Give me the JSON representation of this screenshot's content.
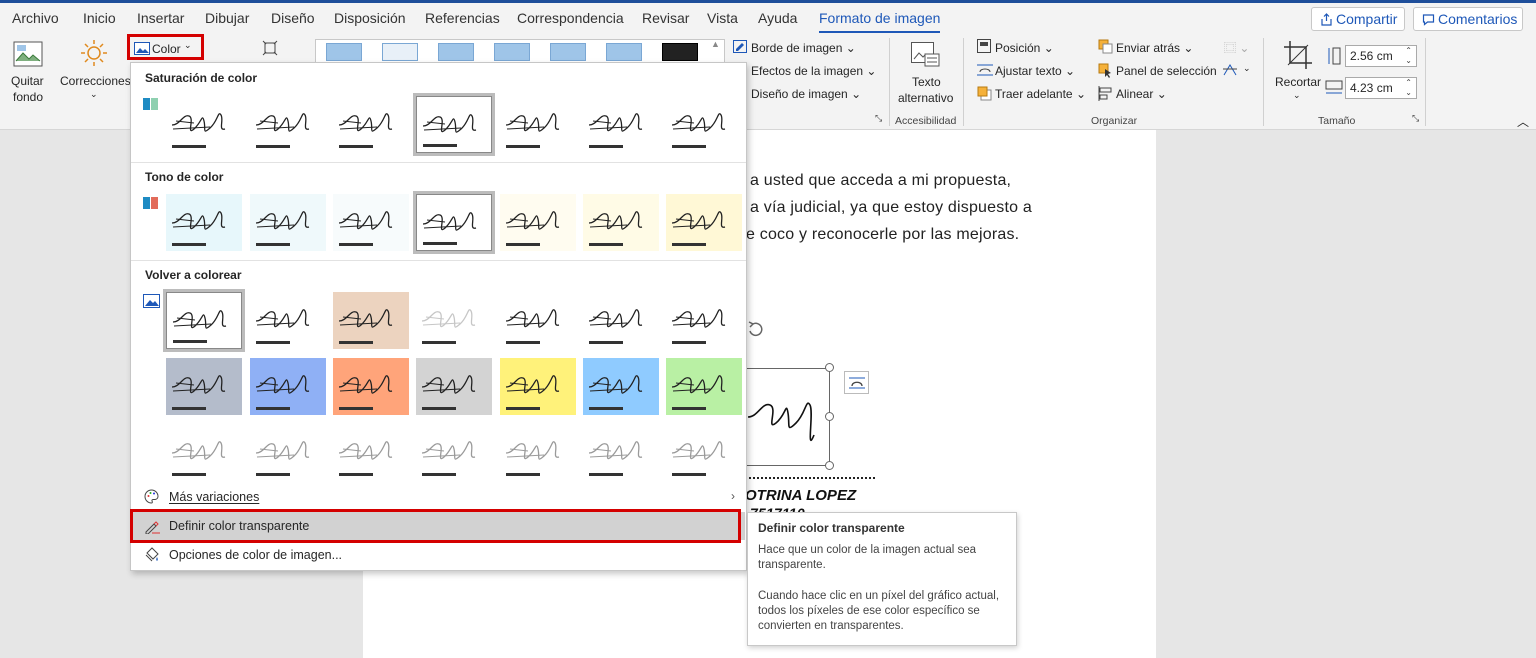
{
  "menu_tabs": [
    "Archivo",
    "Inicio",
    "Insertar",
    "Dibujar",
    "Diseño",
    "Disposición",
    "Referencias",
    "Correspondencia",
    "Revisar",
    "Vista",
    "Ayuda",
    "Formato de imagen"
  ],
  "share_label": "Compartir",
  "comments_label": "Comentarios",
  "ribbon": {
    "quitar_fondo_1": "Quitar",
    "quitar_fondo_2": "fondo",
    "correcciones": "Correcciones",
    "color": "Color",
    "borde": "Borde de imagen",
    "efectos": "Efectos de la imagen",
    "diseno": "Diseño de imagen",
    "texto_alt_1": "Texto",
    "texto_alt_2": "alternativo",
    "accesibilidad": "Accesibilidad",
    "posicion": "Posición",
    "ajustar_texto": "Ajustar texto",
    "traer_adelante": "Traer adelante",
    "enviar_atras": "Enviar atrás",
    "panel_seleccion": "Panel de selección",
    "alinear": "Alinear",
    "organizar": "Organizar",
    "recortar": "Recortar",
    "alto": "2.56 cm",
    "ancho": "4.23 cm",
    "tamano": "Tamaño"
  },
  "dropdown": {
    "saturacion": "Saturación de color",
    "tono": "Tono de color",
    "volver": "Volver a colorear",
    "mas_variaciones": "Más variaciones",
    "definir": "Definir color transparente",
    "opciones": "Opciones de color de imagen...",
    "recolor_colors": [
      [
        "#ffffff",
        "#ffffff",
        "#ecd3bf",
        "#ffffff",
        "#ffffff",
        "#ffffff",
        "#ffffff"
      ],
      [
        "#b4bccb",
        "#8fb0f5",
        "#ffa47a",
        "#d3d3d3",
        "#fff27a",
        "#8fcbff",
        "#b9f0a4"
      ],
      [
        "#ffffff",
        "#ffffff",
        "#ffffff",
        "#ffffff",
        "#ffffff",
        "#ffffff",
        "#ffffff"
      ]
    ],
    "tone_colors": [
      "#e7f7fb",
      "#eff9fb",
      "#f7fbfc",
      "#ffffff",
      "#fffcf0",
      "#fffbe6",
      "#fff8d6"
    ]
  },
  "document": {
    "line1": "a usted que acceda a mi propuesta,",
    "line2": "a vía judicial, ya que estoy dispuesto a",
    "line3": "e coco y reconocerle por las mejoras.",
    "name": "OTRINA LOPEZ"
  },
  "tooltip": {
    "title": "Definir color transparente",
    "p1": "Hace que un color de la imagen actual sea transparente.",
    "p2": "Cuando hace clic en un píxel del gráfico actual, todos los píxeles de ese color específico se convierten en transparentes."
  }
}
